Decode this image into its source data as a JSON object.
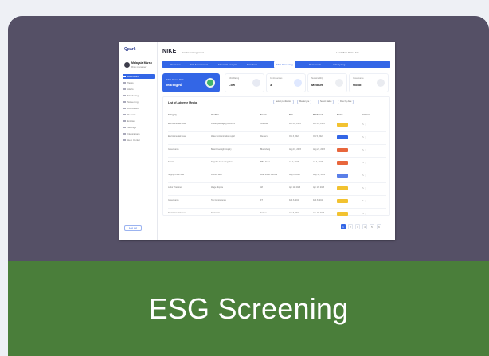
{
  "card": {
    "title": "ESG Screening"
  },
  "screenshot": {
    "sidebar": {
      "logo": "Qpark",
      "user_name": "Malaysia Marsh",
      "user_role": "Risk manager",
      "items": [
        "Dashboard",
        "Tasks",
        "Alerts",
        "Monitoring",
        "Screening",
        "Workflows",
        "Reports",
        "Entities",
        "Settings",
        "Integrations",
        "Help Center"
      ],
      "logout_label": "Log out"
    },
    "brand": "NIKE",
    "brand_sub": "Vendor management",
    "top_right": "Load More Data   Help",
    "tabs": [
      "Overview",
      "Risk Assessment",
      "Financial Analysis",
      "Sanctions",
      "ESG Screening",
      "Documents",
      "Activity Log"
    ],
    "active_tab_index": 4,
    "kpis": {
      "hero_label": "ESG Score Risk",
      "hero_value": "Managed",
      "items": [
        {
          "label": "ESG Rating",
          "value": "Low"
        },
        {
          "label": "Controversies",
          "value": "3"
        },
        {
          "label": "Sustainability",
          "value": "Medium"
        },
        {
          "label": "Governance",
          "value": "Good"
        }
      ]
    },
    "panel": {
      "title": "List of Adverse Media",
      "filters": [
        "Select publication",
        "Media type",
        "Select status",
        "Filter by date"
      ],
      "columns": [
        "Category",
        "Headline",
        "Source",
        "Date",
        "Published",
        "Status",
        "Actions"
      ],
      "rows": [
        {
          "category": "Environmental Issue",
          "headline": "Plastic packaging concerns",
          "source": "Guardian",
          "date": "Dec 12, 2023",
          "published": "Dec 14, 2023",
          "status": "Pending"
        },
        {
          "category": "Environmental Issue",
          "headline": "Water contamination report",
          "source": "Reuters",
          "date": "Oct 3, 2023",
          "published": "Oct 5, 2023",
          "status": "Resolved"
        },
        {
          "category": "Governance",
          "headline": "Board oversight inquiry",
          "source": "Bloomberg",
          "date": "Aug 19, 2023",
          "published": "Aug 21, 2023",
          "status": "Escalated"
        },
        {
          "category": "Social",
          "headline": "Supplier labor allegations",
          "source": "BBC News",
          "date": "Jul 2, 2023",
          "published": "Jul 4, 2023",
          "status": "Escalated"
        },
        {
          "category": "Supply Chain Risk",
          "headline": "Factory audit",
          "source": "Wall Street Journal",
          "date": "May 8, 2023",
          "published": "May 10, 2023",
          "status": "In review"
        },
        {
          "category": "Labor Practices",
          "headline": "Wage dispute",
          "source": "AP",
          "date": "Apr 11, 2023",
          "published": "Apr 13, 2023",
          "status": "Pending"
        },
        {
          "category": "Governance",
          "headline": "Tax transparency",
          "source": "FT",
          "date": "Feb 6, 2023",
          "published": "Feb 8, 2023",
          "status": "Pending"
        },
        {
          "category": "Environmental Issue",
          "headline": "Emissions",
          "source": "Forbes",
          "date": "Jan 9, 2023",
          "published": "Jan 11, 2023",
          "status": "Pending"
        }
      ]
    },
    "pager": [
      "1",
      "2",
      "3",
      "4",
      "5",
      "6"
    ],
    "colors": {
      "accent": "#3366e6",
      "caption_bg": "#4a7e3a",
      "card_bg": "#555066",
      "status_pending": "#f2c230",
      "status_resolved": "#3366e6",
      "status_escalated": "#e8663c",
      "status_review": "#5a7fe8"
    }
  }
}
